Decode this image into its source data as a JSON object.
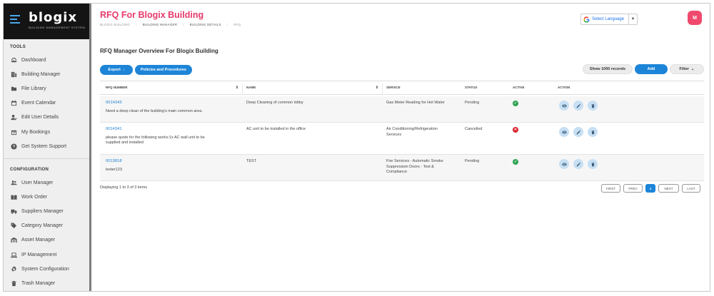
{
  "app": {
    "logo": "blogix",
    "logo_sub": "BUILDING MANAGEMENT SYSTEM"
  },
  "header": {
    "title": "RFQ For Blogix Building",
    "breadcrumb": [
      "BLOGIX BUILDING",
      "BUILDING MANAGER",
      "BUILDING DETAILS",
      "RFQ"
    ],
    "language_label": "Select Language",
    "avatar_initial": "M"
  },
  "sidebar": {
    "tools_label": "TOOLS",
    "tools": [
      {
        "label": "Dashboard",
        "icon": "dashboard-icon"
      },
      {
        "label": "Building Manager",
        "icon": "building-icon"
      },
      {
        "label": "File Library",
        "icon": "folder-icon"
      },
      {
        "label": "Event Calendar",
        "icon": "calendar-icon"
      },
      {
        "label": "Edit User Details",
        "icon": "user-edit-icon"
      },
      {
        "label": "My Bookings",
        "icon": "calendar-check-icon"
      },
      {
        "label": "Get System Support",
        "icon": "question-icon"
      }
    ],
    "config_label": "CONFIGURATION",
    "config": [
      {
        "label": "User Manager",
        "icon": "users-icon"
      },
      {
        "label": "Work Order",
        "icon": "book-icon"
      },
      {
        "label": "Suppliers Manager",
        "icon": "truck-icon"
      },
      {
        "label": "Category Manager",
        "icon": "tags-icon"
      },
      {
        "label": "Asset Manager",
        "icon": "warehouse-icon"
      },
      {
        "label": "IP Management",
        "icon": "laptop-icon"
      },
      {
        "label": "System Configuration",
        "icon": "gear-icon"
      },
      {
        "label": "Trash Manager",
        "icon": "trash-icon"
      }
    ]
  },
  "main": {
    "title": "RFQ Manager Overview For Blogix Building",
    "export_label": "Export",
    "policies_label": "Policies and Procedures",
    "show_records_label": "Show 1000 records",
    "add_label": "Add",
    "filter_label": "Filter"
  },
  "table": {
    "columns": [
      "RFQ NUMBER",
      "NAME",
      "SERVICE",
      "STATUS",
      "ACTIVE",
      "ACTION"
    ],
    "rows": [
      {
        "number": "0014343",
        "desc_lines": [
          "Need a deep clean of the building's main common area."
        ],
        "name": "Deep Cleaning of common lobby",
        "service_lines": [
          "Gas Meter Reading for Hot Water"
        ],
        "status": "Pending",
        "active": true
      },
      {
        "number": "0014341",
        "desc_lines": [
          "please quote for the following works:1x AC wall unit to be",
          "supplied and installed"
        ],
        "name": "AC unit to be installed in the office",
        "service_lines": [
          "Air Conditioning/Refrigeration",
          "Services"
        ],
        "status": "Cancelled",
        "active": false
      },
      {
        "number": "0013818",
        "desc_lines": [
          "tester123"
        ],
        "name": "TEST",
        "service_lines": [
          "Fire Services - Automatic Smoke",
          "Suppression Doors - Test &",
          "Compliance"
        ],
        "status": "Pending",
        "active": true
      }
    ]
  },
  "footer": {
    "info": "Displaying 1 to 3 of 3 items",
    "pagination": [
      "FIRST",
      "PREV",
      "1",
      "NEXT",
      "LAST"
    ],
    "current_page": "1"
  }
}
